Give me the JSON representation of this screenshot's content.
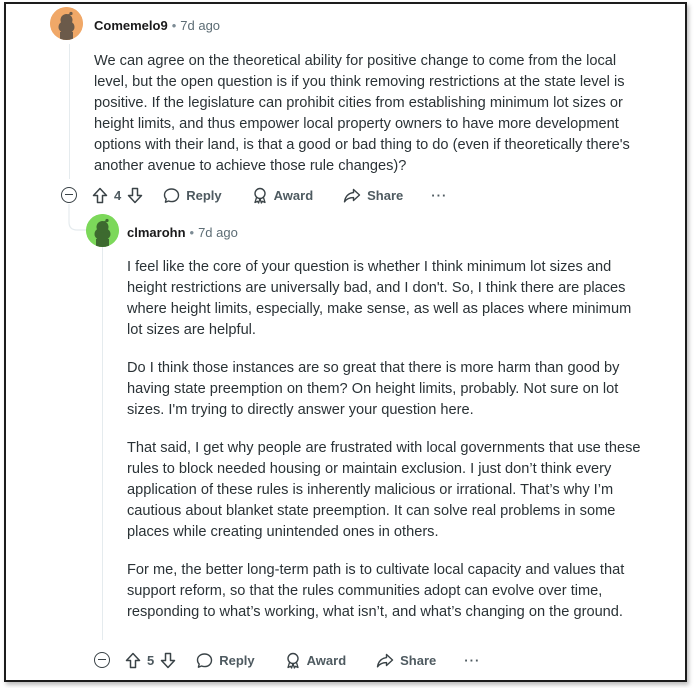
{
  "comments": [
    {
      "author": "Comemelo9",
      "separator": "•",
      "time": "7d ago",
      "paragraphs": [
        "We can agree on the theoretical ability for positive change to come from the local level, but the open question is if you think removing restrictions at the state level is positive. If the legislature can prohibit cities from establishing minimum lot sizes or height limits, and thus empower local property owners to have more development options with their land, is that a good or bad thing to do (even if theoretically there's another avenue to achieve those rule changes)?"
      ],
      "score": "4",
      "reply_label": "Reply",
      "award_label": "Award",
      "share_label": "Share",
      "more_label": "···",
      "avatar_color": "#f4a460"
    },
    {
      "author": "clmarohn",
      "separator": "•",
      "time": "7d ago",
      "paragraphs": [
        "I feel like the core of your question is whether I think minimum lot sizes and height restrictions are universally bad, and I don't. So, I think there are places where height limits, especially, make sense, as well as places where minimum lot sizes are helpful.",
        "Do I think those instances are so great that there is more harm than good by having state preemption on them? On height limits, probably. Not sure on lot sizes. I'm trying to directly answer your question here.",
        "That said, I get why people are frustrated with local governments that use these rules to block needed housing or maintain exclusion. I just don’t think every application of these rules is inherently malicious or irrational. That’s why I’m cautious about blanket state preemption. It can solve real problems in some places while creating unintended ones in others.",
        "For me, the better long-term path is to cultivate local capacity and values that support reform, so that the rules communities adopt can evolve over time, responding to what’s working, what isn’t, and what’s changing on the ground."
      ],
      "score": "5",
      "reply_label": "Reply",
      "award_label": "Award",
      "share_label": "Share",
      "more_label": "···",
      "avatar_color": "#7ed957"
    }
  ]
}
